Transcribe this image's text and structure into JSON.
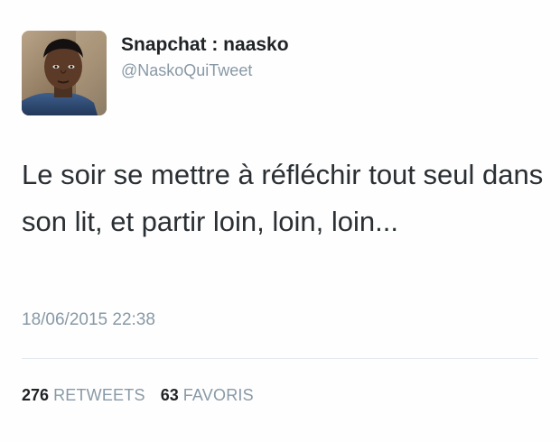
{
  "user": {
    "display_name": "Snapchat : naasko",
    "handle": "@NaskoQuiTweet"
  },
  "tweet": {
    "text": "Le soir se mettre à réfléchir tout seul dans son lit, et partir loin, loin, loin...",
    "timestamp": "18/06/2015 22:38"
  },
  "stats": {
    "retweets_count": "276",
    "retweets_label": "RETWEETS",
    "favorites_count": "63",
    "favorites_label": "FAVORIS"
  },
  "colors": {
    "secondary_text": "#8899a6",
    "primary_text": "#292f33",
    "divider": "#e1e8ed"
  }
}
